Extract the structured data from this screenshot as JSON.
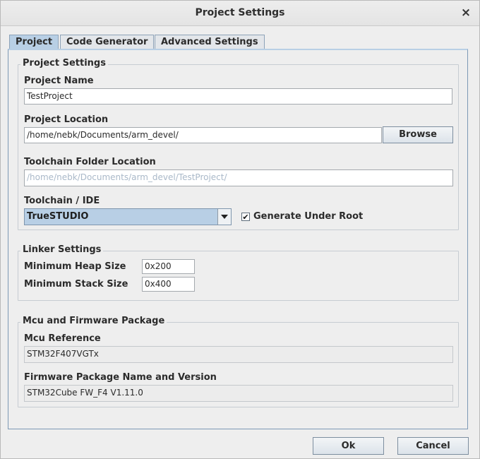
{
  "window": {
    "title": "Project Settings",
    "close_glyph": "×"
  },
  "tabs": [
    {
      "label": "Project",
      "active": true
    },
    {
      "label": "Code Generator",
      "active": false
    },
    {
      "label": "Advanced Settings",
      "active": false
    }
  ],
  "project_settings": {
    "legend": "Project Settings",
    "project_name_label": "Project Name",
    "project_name_value": "TestProject",
    "project_location_label": "Project Location",
    "project_location_value": "/home/nebk/Documents/arm_devel/",
    "browse_label": "Browse",
    "toolchain_folder_label": "Toolchain Folder Location",
    "toolchain_folder_value": "/home/nebk/Documents/arm_devel/TestProject/",
    "toolchain_ide_label": "Toolchain / IDE",
    "toolchain_ide_value": "TrueSTUDIO",
    "generate_under_root_label": "Generate Under Root",
    "generate_under_root_checked": true,
    "check_glyph": "✔"
  },
  "linker_settings": {
    "legend": "Linker Settings",
    "min_heap_label": "Minimum Heap Size",
    "min_heap_value": "0x200",
    "min_stack_label": "Minimum Stack Size",
    "min_stack_value": "0x400"
  },
  "mcu_package": {
    "legend": "Mcu and Firmware Package",
    "mcu_reference_label": "Mcu Reference",
    "mcu_reference_value": "STM32F407VGTx",
    "firmware_label": "Firmware Package Name and Version",
    "firmware_value": "STM32Cube FW_F4 V1.11.0"
  },
  "footer": {
    "ok_label": "Ok",
    "cancel_label": "Cancel"
  },
  "colors": {
    "accent": "#b8cfe5",
    "border": "#7d99b5",
    "background": "#eeeeee"
  },
  "icons": {
    "close": "close-icon",
    "dropdown": "chevron-down-icon",
    "check": "checkmark-icon"
  }
}
